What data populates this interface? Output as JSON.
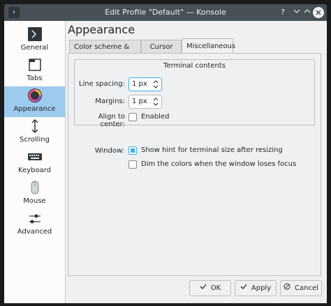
{
  "window": {
    "title": "Edit Profile \"Default\" — Konsole",
    "help_label": "?"
  },
  "sidebar": {
    "items": [
      {
        "label": "General"
      },
      {
        "label": "Tabs"
      },
      {
        "label": "Appearance"
      },
      {
        "label": "Scrolling"
      },
      {
        "label": "Keyboard"
      },
      {
        "label": "Mouse"
      },
      {
        "label": "Advanced"
      }
    ]
  },
  "page": {
    "title": "Appearance"
  },
  "tabs": [
    {
      "label": "Color scheme & font"
    },
    {
      "label": "Cursor"
    },
    {
      "label": "Miscellaneous"
    }
  ],
  "terminal_contents": {
    "title": "Terminal contents",
    "line_spacing_label": "Line spacing:",
    "line_spacing_value": "1 px",
    "margins_label": "Margins:",
    "margins_value": "1 px",
    "align_label": "Align to center:",
    "align_option": "Enabled",
    "align_checked": false
  },
  "window_group": {
    "label": "Window:",
    "show_hint": "Show hint for terminal size after resizing",
    "show_hint_checked": true,
    "dim_colors": "Dim the colors when the window loses focus",
    "dim_colors_checked": false
  },
  "buttons": {
    "ok": "OK",
    "apply": "Apply",
    "cancel": "Cancel"
  },
  "colors": {
    "accent": "#3daee9",
    "selection": "#9ccbee",
    "titlebar": "#475057"
  }
}
